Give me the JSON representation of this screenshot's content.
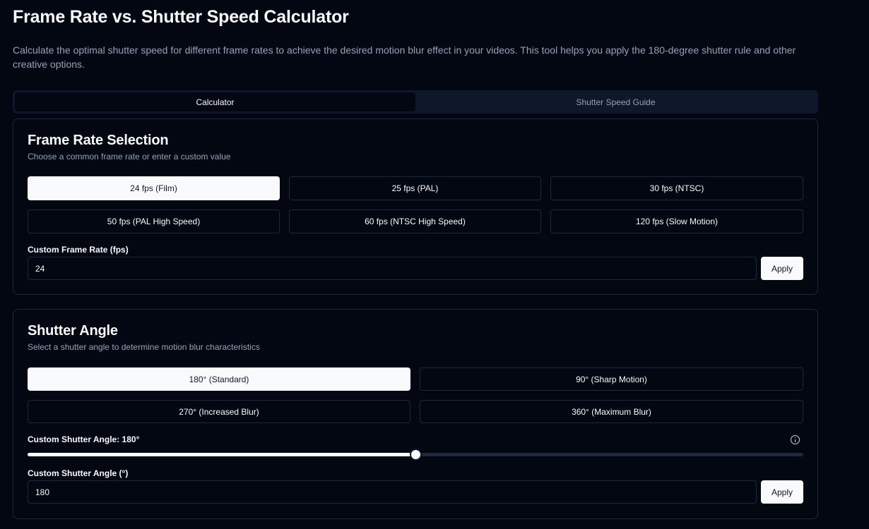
{
  "page": {
    "title": "Frame Rate vs. Shutter Speed Calculator",
    "description": "Calculate the optimal shutter speed for different frame rates to achieve the desired motion blur effect in your videos. This tool helps you apply the 180-degree shutter rule and other creative options."
  },
  "tabs": [
    {
      "label": "Calculator",
      "active": true
    },
    {
      "label": "Shutter Speed Guide",
      "active": false
    }
  ],
  "frame_rate": {
    "title": "Frame Rate Selection",
    "subtitle": "Choose a common frame rate or enter a custom value",
    "options": [
      {
        "label": "24 fps (Film)",
        "selected": true
      },
      {
        "label": "25 fps (PAL)",
        "selected": false
      },
      {
        "label": "30 fps (NTSC)",
        "selected": false
      },
      {
        "label": "50 fps (PAL High Speed)",
        "selected": false
      },
      {
        "label": "60 fps (NTSC High Speed)",
        "selected": false
      },
      {
        "label": "120 fps (Slow Motion)",
        "selected": false
      }
    ],
    "custom_label": "Custom Frame Rate (fps)",
    "custom_value": "24",
    "apply_label": "Apply"
  },
  "shutter_angle": {
    "title": "Shutter Angle",
    "subtitle": "Select a shutter angle to determine motion blur characteristics",
    "options": [
      {
        "label": "180° (Standard)",
        "selected": true
      },
      {
        "label": "90° (Sharp Motion)",
        "selected": false
      },
      {
        "label": "270° (Increased Blur)",
        "selected": false
      },
      {
        "label": "360° (Maximum Blur)",
        "selected": false
      }
    ],
    "slider_label": "Custom Shutter Angle: 180°",
    "slider_value": 180,
    "slider_max": 360,
    "custom_label": "Custom Shutter Angle (°)",
    "custom_value": "180",
    "apply_label": "Apply"
  },
  "colors": {
    "background": "#030712",
    "border": "#1e293b",
    "foreground": "#f8fafc",
    "muted": "#94a3b8"
  }
}
